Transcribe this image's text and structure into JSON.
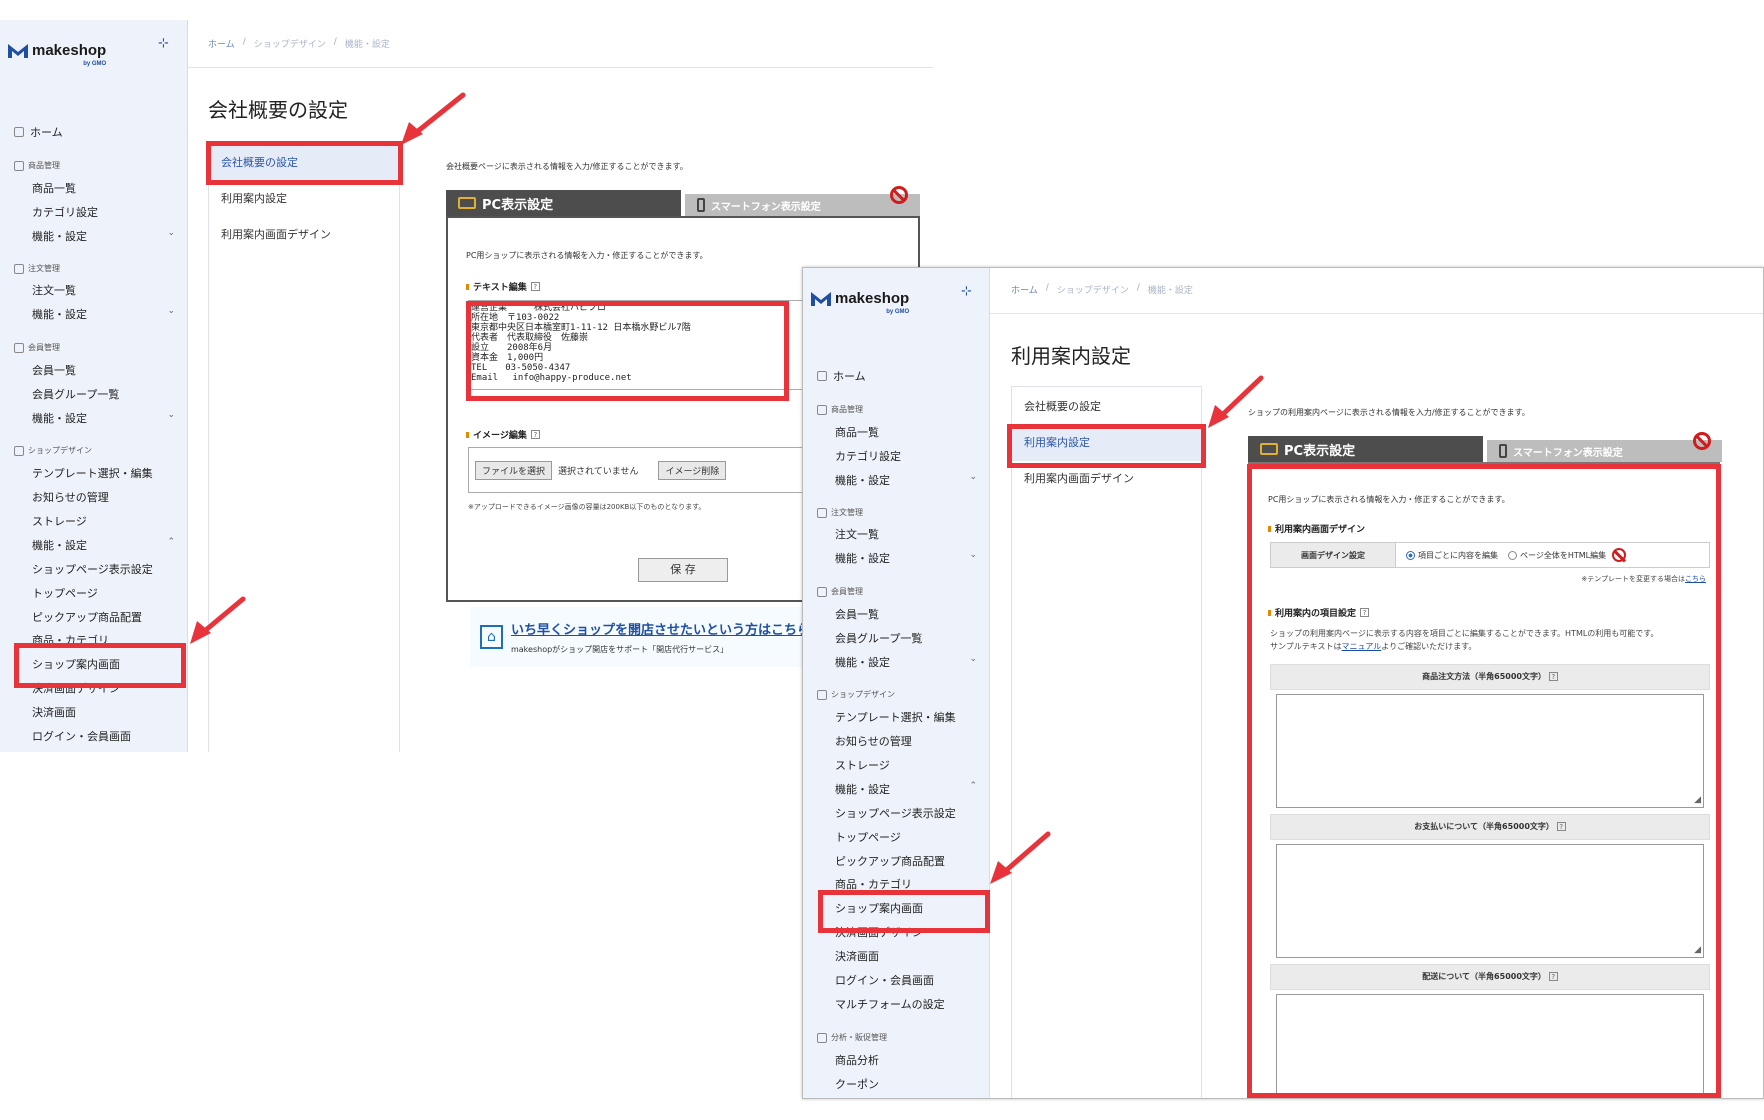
{
  "sidebar": {
    "brand": "makeshop",
    "brand_sub": "by GMO",
    "home": "ホーム",
    "sections": {
      "product": "商品管理",
      "order": "注文管理",
      "member": "会員管理",
      "design": "ショップデザイン",
      "analysis": "分析・販促管理"
    },
    "items": {
      "product_list": "商品一覧",
      "category": "カテゴリ設定",
      "features": "機能・設定",
      "order_list": "注文一覧",
      "member_list": "会員一覧",
      "member_groups": "会員グループ一覧",
      "template": "テンプレート選択・編集",
      "news": "お知らせの管理",
      "storage": "ストレージ",
      "shop_page": "ショップページ表示設定",
      "top_page": "トップページ",
      "pickup": "ピックアップ商品配置",
      "product_category": "商品・カテゴリ",
      "shop_guide": "ショップ案内画面",
      "checkout_design": "決済画面デザイン",
      "checkout": "決済画面",
      "login": "ログイン・会員画面",
      "multiform": "マルチフォームの設定",
      "product_analysis": "商品分析",
      "coupon": "クーポン"
    }
  },
  "breadcrumb": {
    "home": "ホーム",
    "design": "ショップデザイン",
    "features": "機能・設定"
  },
  "subnav": {
    "company": "会社概要の設定",
    "guide": "利用案内設定",
    "guide_design": "利用案内画面デザイン"
  },
  "screen1": {
    "title": "会社概要の設定",
    "description": "会社概要ページに表示される情報を入力/修正することができます。",
    "tab_pc": "PC表示設定",
    "tab_sp": "スマートフォン表示設定",
    "panel_desc": "PC用ショップに表示される情報を入力・修正することができます。",
    "text_label": "テキスト編集",
    "text_content": "運営企業　　　株式会社ハピプロ\n所在地　〒103-0022\n東京都中央区日本橋室町1-11-12 日本橋水野ビル7階\n代表者　代表取締役　佐藤崇\n設立　　2008年6月\n資本金　1,000円\nTEL　　03-5050-4347\nEmail　 info@happy-produce.net",
    "image_label": "イメージ編集",
    "file_button": "ファイルを選択",
    "file_status": "選択されていません",
    "image_delete": "イメージ削除",
    "upload_note": "※アップロードできるイメージ画像の容量は200KB以下のものとなります。",
    "save": "保 存",
    "banner_link": "いち早くショップを開店させたいという方はこちら",
    "banner_sub": "makeshopがショップ開店をサポート「開店代行サービス」"
  },
  "screen2": {
    "title": "利用案内設定",
    "description": "ショップの利用案内ページに表示される情報を入力/修正することができます。",
    "tab_pc": "PC表示設定",
    "tab_sp": "スマートフォン表示設定",
    "panel_desc": "PC用ショップに表示される情報を入力・修正することができます。",
    "design_label": "利用案内画面デザイン",
    "design_setting": "画面デザイン設定",
    "radio_item": "項目ごとに内容を編集",
    "radio_html": "ページ全体をHTML編集",
    "template_note": "※テンプレートを変更する場合は",
    "template_link": "こちら",
    "items_label": "利用案内の項目設定",
    "items_desc": "ショップの利用案内ページに表示する内容を項目ごとに編集することができます。HTMLの利用も可能です。",
    "sample_prefix": "サンプルテキストは",
    "sample_link": "マニュアル",
    "sample_suffix": "よりご確認いただけます。",
    "field1": "商品注文方法（半角65000文字）",
    "field2": "お支払いについて（半角65000文字）",
    "field3": "配送について（半角65000文字）"
  },
  "colors": {
    "highlight": "#e8333b",
    "sidebar_bg": "#eef2fa",
    "active_link": "#2a56a8"
  }
}
